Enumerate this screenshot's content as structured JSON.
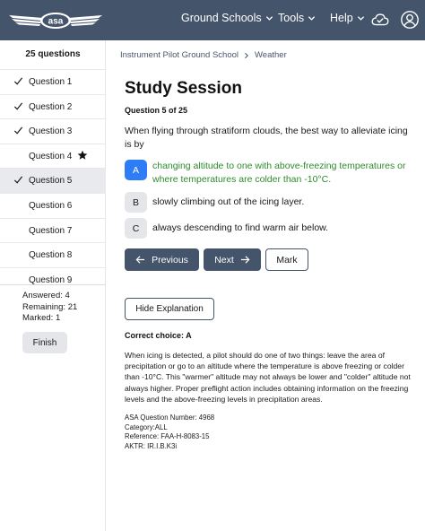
{
  "header": {
    "logo_text": "asa",
    "nav": {
      "ground_schools": "Ground Schools",
      "tools": "Tools",
      "help": "Help"
    },
    "icons": [
      "check-cloud-icon",
      "user-icon",
      "chevron-down-icon"
    ]
  },
  "sidebar": {
    "title": "25 questions",
    "items": [
      {
        "label": "Question 1",
        "answered": true
      },
      {
        "label": "Question 2",
        "answered": true
      },
      {
        "label": "Question 3",
        "answered": true
      },
      {
        "label": "Question 4",
        "answered": false,
        "marked": true
      },
      {
        "label": "Question 5",
        "answered": true,
        "current": true
      },
      {
        "label": "Question 6",
        "answered": false
      },
      {
        "label": "Question 7",
        "answered": false
      },
      {
        "label": "Question 8",
        "answered": false
      },
      {
        "label": "Question 9",
        "answered": false
      }
    ],
    "stats": {
      "answered": "Answered: 4",
      "remaining": "Remaining: 21",
      "marked": "Marked: 1"
    },
    "finish_label": "Finish"
  },
  "breadcrumb": {
    "course": "Instrument Pilot Ground School",
    "topic": "Weather"
  },
  "main": {
    "title": "Study Session",
    "counter": "Question 5 of 25",
    "question": "When flying through stratiform clouds, the best way to alleviate icing is by",
    "choices": [
      {
        "letter": "A",
        "text": "changing altitude to one with above-freezing temperatures or where temperatures are colder than -10°C.",
        "selected": true,
        "correct": true
      },
      {
        "letter": "B",
        "text": "slowly climbing out of the icing layer.",
        "selected": false
      },
      {
        "letter": "C",
        "text": "always descending to find warm air below.",
        "selected": false
      }
    ],
    "buttons": {
      "previous": "Previous",
      "next": "Next",
      "mark": "Mark",
      "hide_explanation": "Hide Explanation"
    },
    "correct_choice": "Correct choice: A",
    "explanation": "When icing is detected, a pilot should do one of two things: leave the area of precipitation or go to an altitude where the temperature is above freezing or colder than -10°C. This \"warmer\" altitude may not always be lower and \"colder\" altitude not always higher. Proper preflight action includes obtaining information on the freezing levels and the above-freezing levels in precipitation areas.",
    "meta": {
      "question_number": "ASA Question Number: 4968",
      "category": "Category:ALL",
      "reference": "Reference: FAA-H-8083-15",
      "aktr": "AKTR: IR.I.B.K3i"
    }
  },
  "colors": {
    "header_bg": "#44546b",
    "selected_choice": "#2f7df6",
    "correct_text": "#2e8b2e"
  }
}
